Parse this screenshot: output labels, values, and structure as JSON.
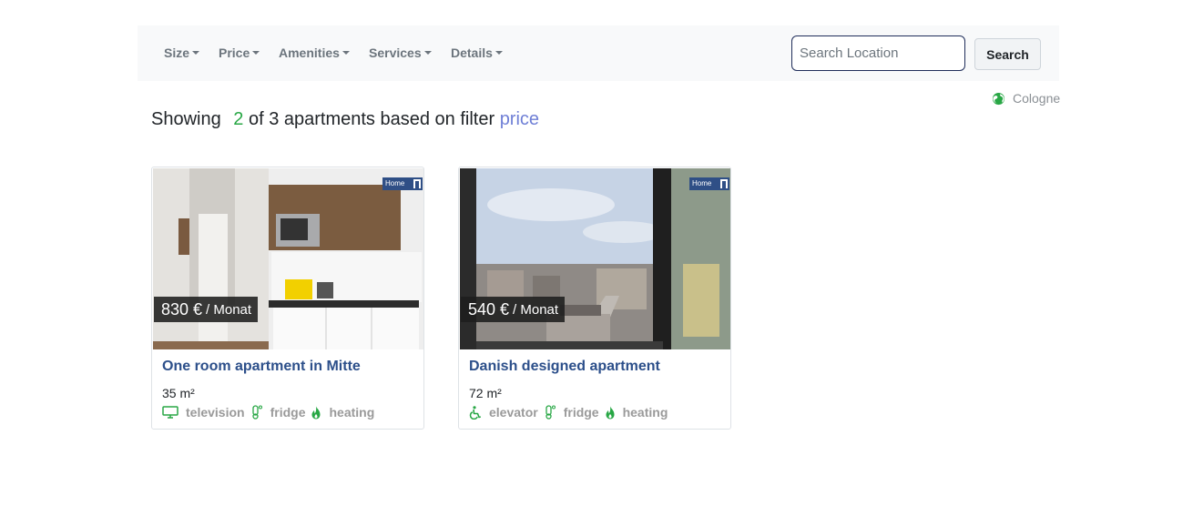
{
  "nav": {
    "menus": [
      {
        "label": "Size"
      },
      {
        "label": "Price"
      },
      {
        "label": "Amenities"
      },
      {
        "label": "Services"
      },
      {
        "label": "Details"
      }
    ],
    "search": {
      "placeholder": "Search Location",
      "value": "",
      "button_label": "Search"
    }
  },
  "location": {
    "city": "Cologne",
    "icon": "globe-icon"
  },
  "results": {
    "prefix": "Showing",
    "count": "2",
    "middle": "of 3 apartments based on filter",
    "filter": "price"
  },
  "listings": [
    {
      "price": "830 €",
      "price_unit": "/ Monat",
      "title": "One room apartment in Mitte",
      "size": "35 m²",
      "amenities": [
        {
          "label": "television",
          "icon": "tv-icon"
        },
        {
          "label": "fridge",
          "icon": "thermometer-icon"
        },
        {
          "label": "heating",
          "icon": "flame-icon"
        }
      ],
      "photo": "kitchenette-photo",
      "logo": "Home"
    },
    {
      "price": "540 €",
      "price_unit": "/ Monat",
      "title": "Danish designed apartment",
      "size": "72 m²",
      "amenities": [
        {
          "label": "elevator",
          "icon": "wheelchair-icon"
        },
        {
          "label": "fridge",
          "icon": "thermometer-icon"
        },
        {
          "label": "heating",
          "icon": "flame-icon"
        }
      ],
      "photo": "city-view-photo",
      "logo": "Home"
    }
  ],
  "colors": {
    "accent_green": "#28a745",
    "filter_link": "#6f7fd6",
    "title_blue": "#2c4f8a",
    "navbar_bg": "#f8f9fa"
  }
}
